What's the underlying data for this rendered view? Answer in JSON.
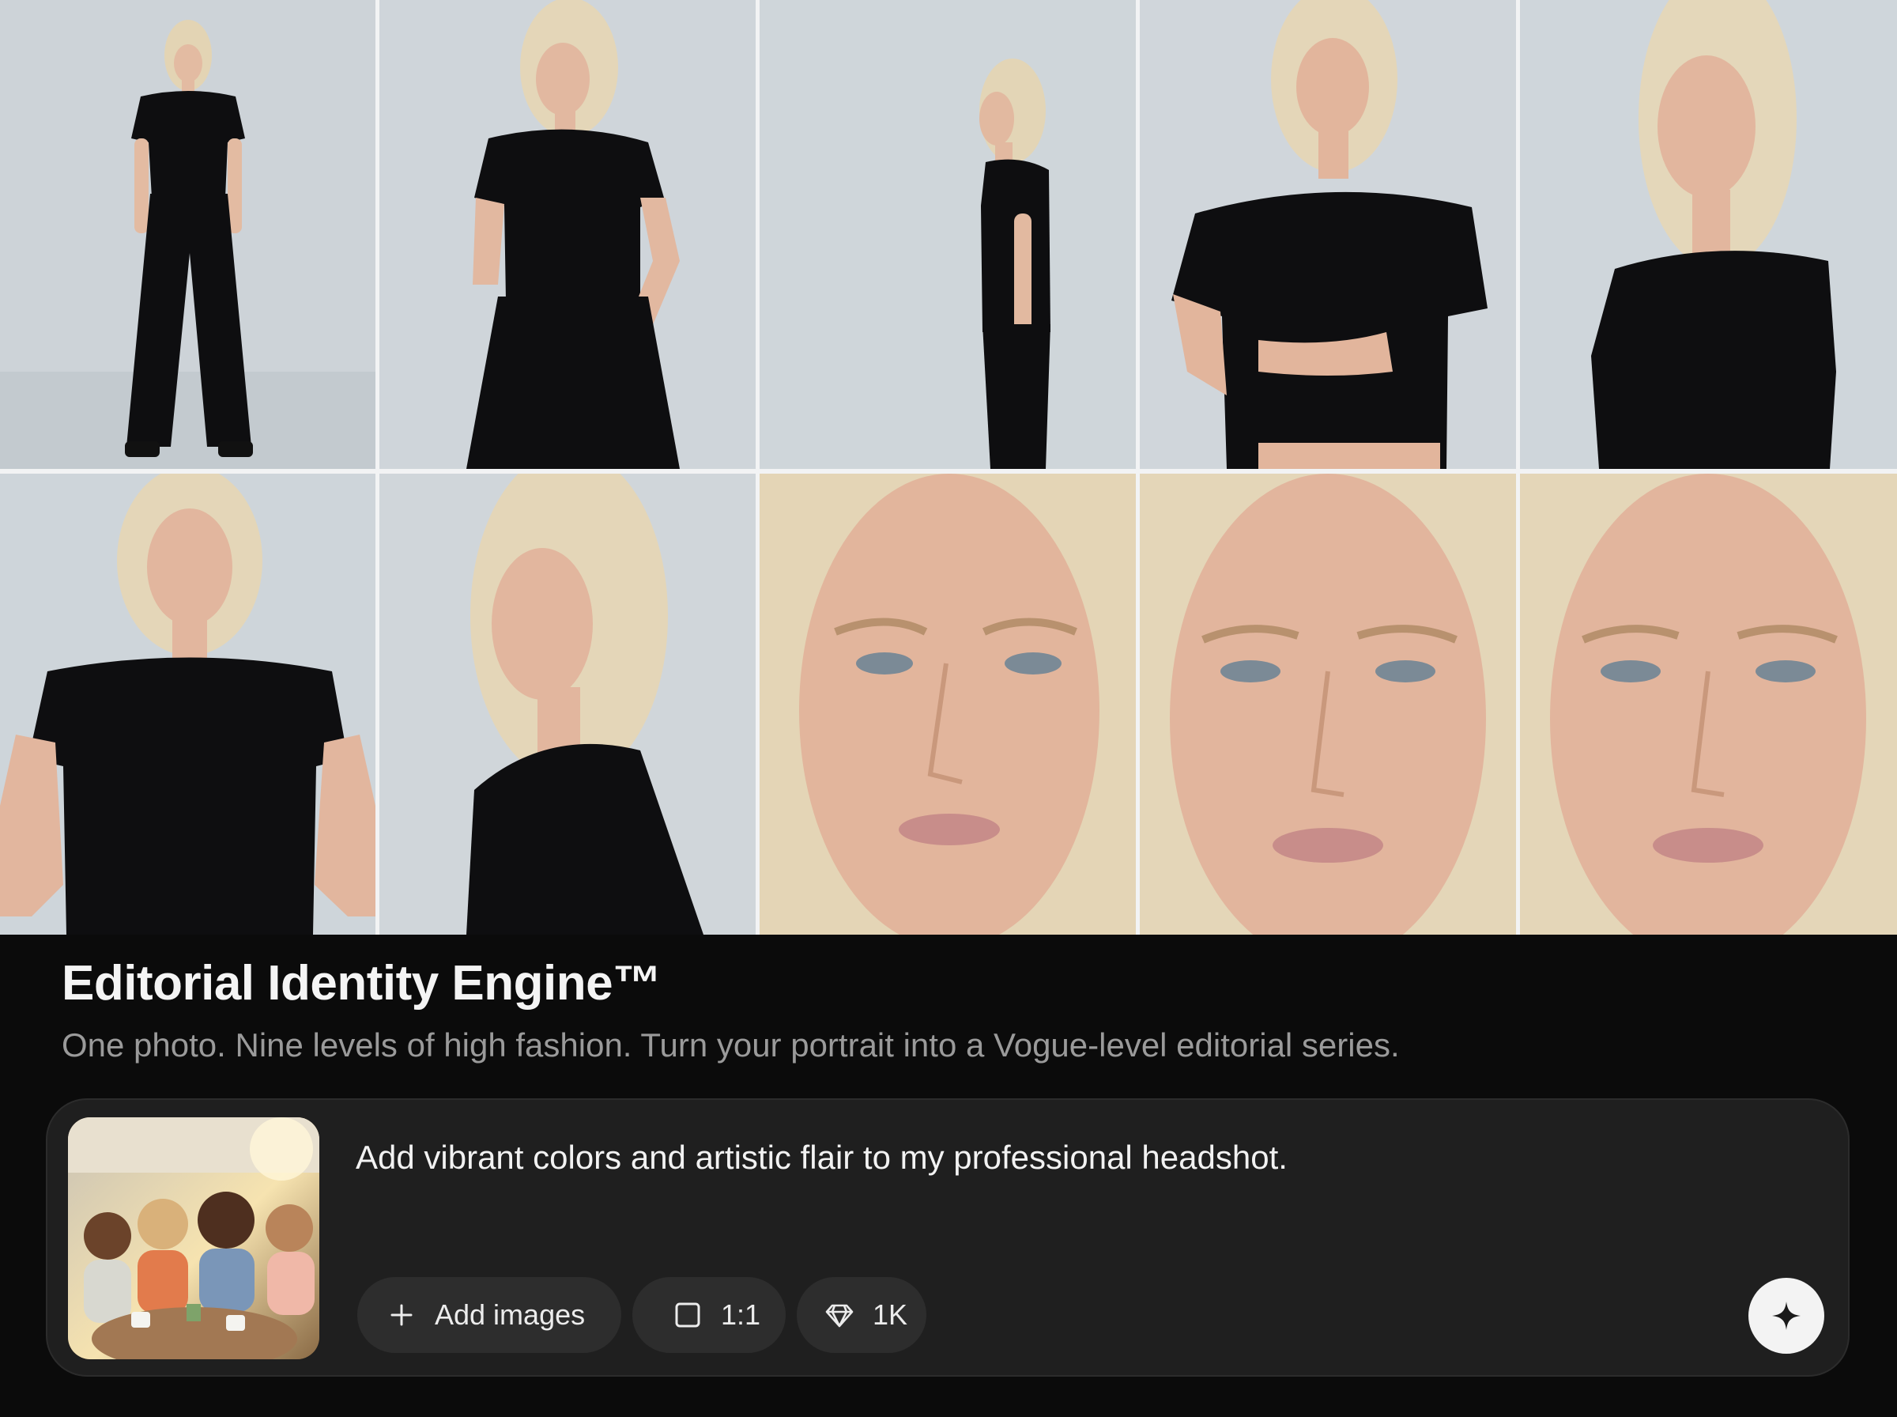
{
  "gallery": {
    "tiles": [
      {
        "name": "full-body-front"
      },
      {
        "name": "three-quarter-pose"
      },
      {
        "name": "side-profile-standing"
      },
      {
        "name": "waist-up-shirt-lift"
      },
      {
        "name": "shoulder-profile"
      },
      {
        "name": "hands-on-hips"
      },
      {
        "name": "turned-portrait"
      },
      {
        "name": "face-closeup-1"
      },
      {
        "name": "face-closeup-2"
      },
      {
        "name": "face-closeup-3"
      }
    ]
  },
  "feature": {
    "title": "Editorial Identity Engine™",
    "subtitle": "One photo. Nine levels of high fashion. Turn your portrait into a Vogue-level editorial series."
  },
  "prompt": {
    "text": "Add vibrant colors and artistic flair to my professional headshot.",
    "reference_image": "friends-at-cafe-photo"
  },
  "toolbar": {
    "add_images_label": "Add images",
    "add_icon": "plus-icon",
    "aspect_ratio_label": "1:1",
    "aspect_icon": "square-icon",
    "resolution_label": "1K",
    "resolution_icon": "diamond-icon",
    "send_icon": "sparkle-icon"
  },
  "colors": {
    "background": "#0b0b0b",
    "card": "#1f1f1f",
    "chip": "#2d2d2d",
    "send_button": "#f3f3f3",
    "studio_backdrop": "#c9d0d5",
    "outfit": "#0e0e10",
    "hair": "#e2d3b3",
    "skin": "#e2b9a0"
  }
}
